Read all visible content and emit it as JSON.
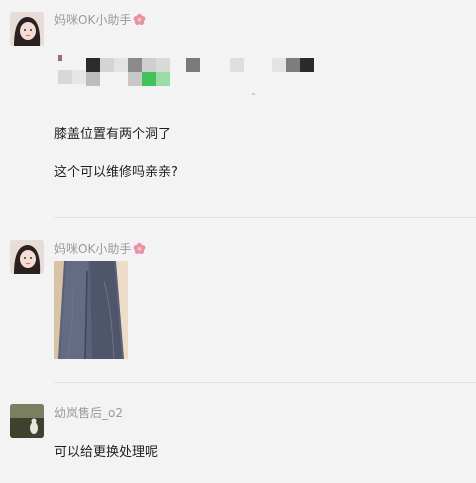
{
  "messages": [
    {
      "sender": "妈咪OK小助手",
      "lines": [
        "膝盖位置有两个洞了",
        "这个可以维修吗亲亲?"
      ]
    },
    {
      "sender": "妈咪OK小助手",
      "attachment": "photo-of-pants"
    },
    {
      "sender": "幼岚售后_o2",
      "lines": [
        "可以给更换处理呢"
      ]
    }
  ],
  "colors": {
    "background": "#f3f3f3",
    "name_text": "#9a9a9a",
    "body_text": "#1e1e1e",
    "mosaic_green": "#43c15a"
  }
}
